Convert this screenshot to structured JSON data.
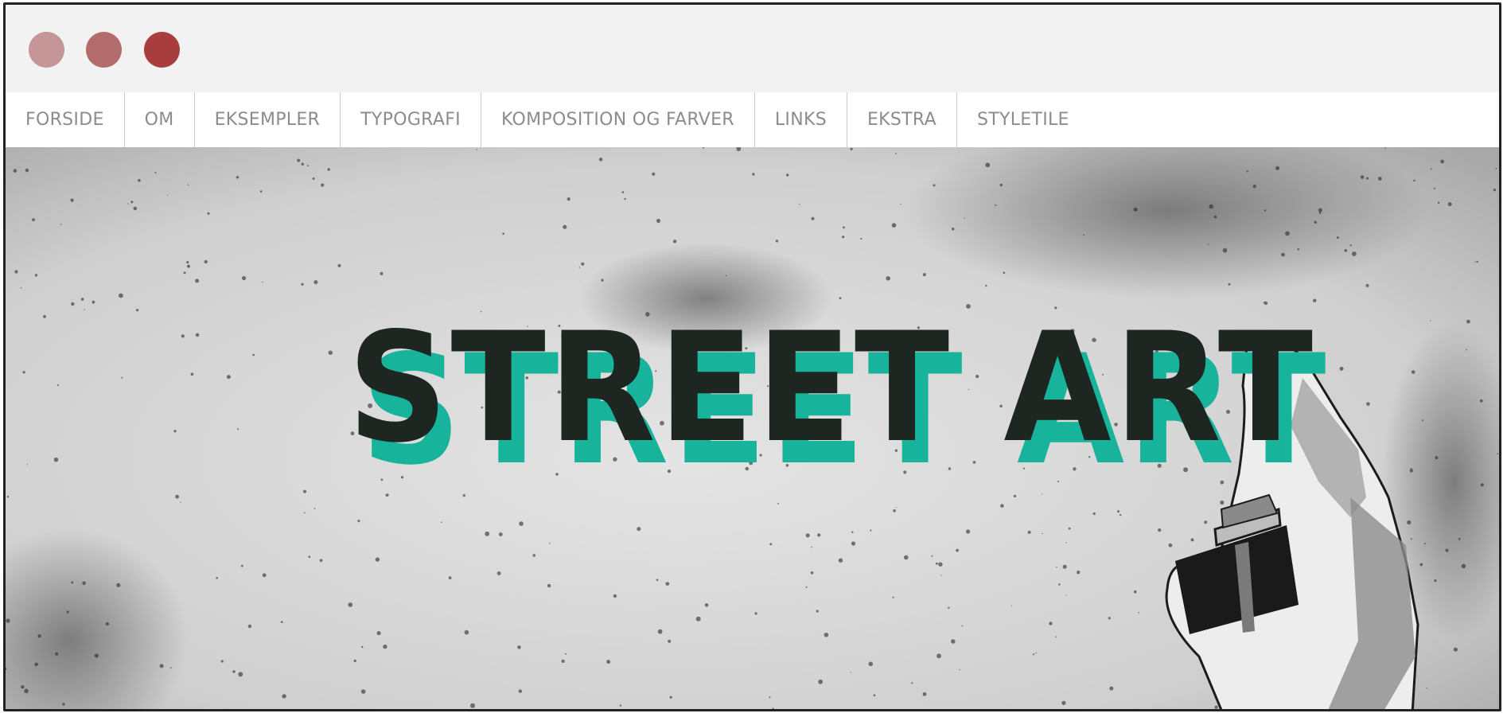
{
  "window": {
    "controls": [
      {
        "name": "window-control-1",
        "color": "#c49697"
      },
      {
        "name": "window-control-2",
        "color": "#b36b6b"
      },
      {
        "name": "window-control-3",
        "color": "#a83d3d"
      }
    ]
  },
  "nav": {
    "items": [
      {
        "label": "FORSIDE"
      },
      {
        "label": "OM"
      },
      {
        "label": "EKSEMPLER"
      },
      {
        "label": "TYPOGRAFI"
      },
      {
        "label": "KOMPOSITION OG FARVER"
      },
      {
        "label": "LINKS"
      },
      {
        "label": "EKSTRA"
      },
      {
        "label": "STYLETILE"
      }
    ]
  },
  "hero": {
    "title": "STREET ART",
    "accent_color": "#17b39b",
    "text_color": "#1e2621",
    "background": "concrete-wall-texture",
    "illustration": "spray-can-hand-icon"
  }
}
